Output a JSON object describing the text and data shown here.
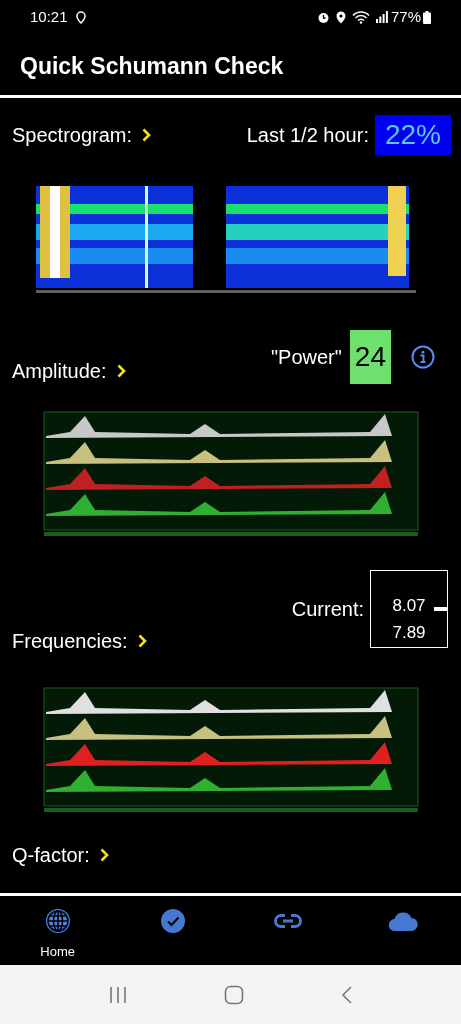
{
  "status_bar": {
    "time": "10:21",
    "battery": "77%"
  },
  "title": "Quick Schumann Check",
  "sections": [
    {
      "kind": "spectrogram",
      "label": "Spectrogram:",
      "badge": {
        "label": "Last 1/2 hour:",
        "value": "22%"
      }
    },
    {
      "kind": "amplitude",
      "label": "Amplitude:",
      "badge": {
        "label": "\"Power\"",
        "value": "24"
      }
    },
    {
      "kind": "frequencies",
      "label": "Frequencies:",
      "current": {
        "label": "Current:",
        "readings": [
          "8.07",
          "7.89"
        ]
      }
    },
    {
      "kind": "qfactor",
      "label": "Q-factor:"
    }
  ],
  "bottom_nav": [
    {
      "label": "Home",
      "selected": true
    },
    {
      "selected": false
    },
    {
      "selected": false
    },
    {
      "selected": false
    }
  ]
}
